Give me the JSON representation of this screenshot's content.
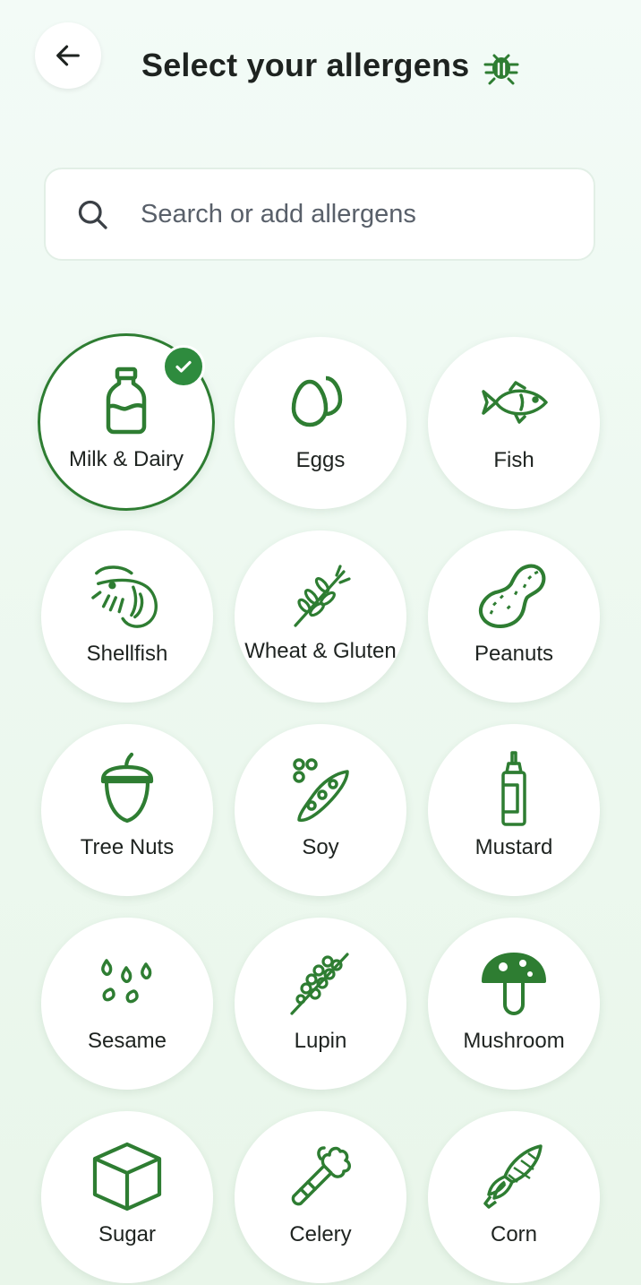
{
  "header": {
    "title": "Select your allergens",
    "back_icon": "arrow-left-icon",
    "title_icon": "bug-icon"
  },
  "search": {
    "placeholder": "Search or add allergens",
    "icon": "search-icon"
  },
  "colors": {
    "accent": "#2e7d32",
    "check": "#2e8b3e",
    "background": "#eef9f1"
  },
  "allergens": [
    {
      "label": "Milk & Dairy",
      "icon": "milk-bottle-icon",
      "selected": true
    },
    {
      "label": "Eggs",
      "icon": "eggs-icon",
      "selected": false
    },
    {
      "label": "Fish",
      "icon": "fish-icon",
      "selected": false
    },
    {
      "label": "Shellfish",
      "icon": "shrimp-icon",
      "selected": false
    },
    {
      "label": "Wheat & Gluten",
      "icon": "wheat-icon",
      "selected": false
    },
    {
      "label": "Peanuts",
      "icon": "peanut-icon",
      "selected": false
    },
    {
      "label": "Tree Nuts",
      "icon": "acorn-icon",
      "selected": false
    },
    {
      "label": "Soy",
      "icon": "soybean-icon",
      "selected": false
    },
    {
      "label": "Mustard",
      "icon": "mustard-bottle-icon",
      "selected": false
    },
    {
      "label": "Sesame",
      "icon": "sesame-seeds-icon",
      "selected": false
    },
    {
      "label": "Lupin",
      "icon": "lupin-icon",
      "selected": false
    },
    {
      "label": "Mushroom",
      "icon": "mushroom-icon",
      "selected": false
    },
    {
      "label": "Sugar",
      "icon": "sugar-cube-icon",
      "selected": false
    },
    {
      "label": "Celery",
      "icon": "celery-icon",
      "selected": false
    },
    {
      "label": "Corn",
      "icon": "corn-icon",
      "selected": false
    }
  ]
}
